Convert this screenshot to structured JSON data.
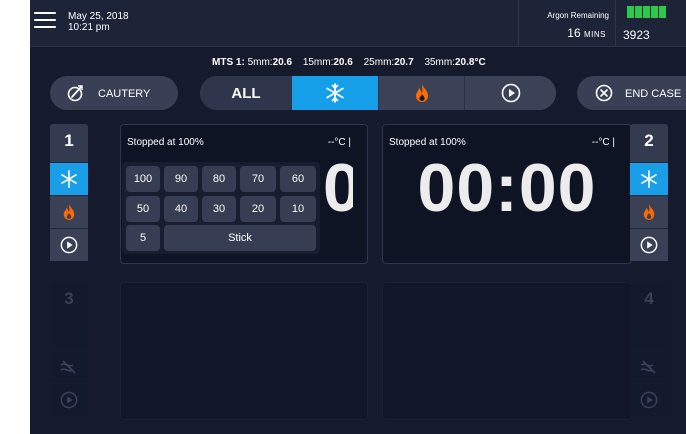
{
  "header": {
    "date": "May 25, 2018",
    "time": "10:21 pm",
    "argon_label": "Argon Remaining",
    "argon_value": "16",
    "argon_unit": "MINS",
    "pressure_value": "3923",
    "battery_bars": 5,
    "battery_color": "#2cc94a"
  },
  "mts": {
    "label": "MTS 1:",
    "items": [
      {
        "size": "5mm:",
        "value": "20.6"
      },
      {
        "size": "15mm:",
        "value": "20.6"
      },
      {
        "size": "25mm:",
        "value": "20.7"
      },
      {
        "size": "35mm:",
        "value": "20.8°C"
      }
    ]
  },
  "controls": {
    "cautery_label": "CAUTERY",
    "all_label": "ALL",
    "end_case_label": "END CASE",
    "active_color": "#159fe8"
  },
  "channels": [
    {
      "number": "1",
      "status": "Stopped at 100%",
      "temp": "--°C |",
      "timer": "0"
    },
    {
      "number": "2",
      "status": "Stopped at 100%",
      "temp": "--°C |",
      "timer": "00:00"
    },
    {
      "number": "3"
    },
    {
      "number": "4"
    }
  ],
  "power_popup": {
    "row1": [
      "100",
      "90",
      "80",
      "70",
      "60"
    ],
    "row2": [
      "50",
      "40",
      "30",
      "20",
      "10"
    ],
    "row3_value": "5",
    "stick_label": "Stick"
  },
  "colors": {
    "background": "#151a2c",
    "cool_blue": "#159fe8",
    "heat_orange": "#ff6a00"
  }
}
